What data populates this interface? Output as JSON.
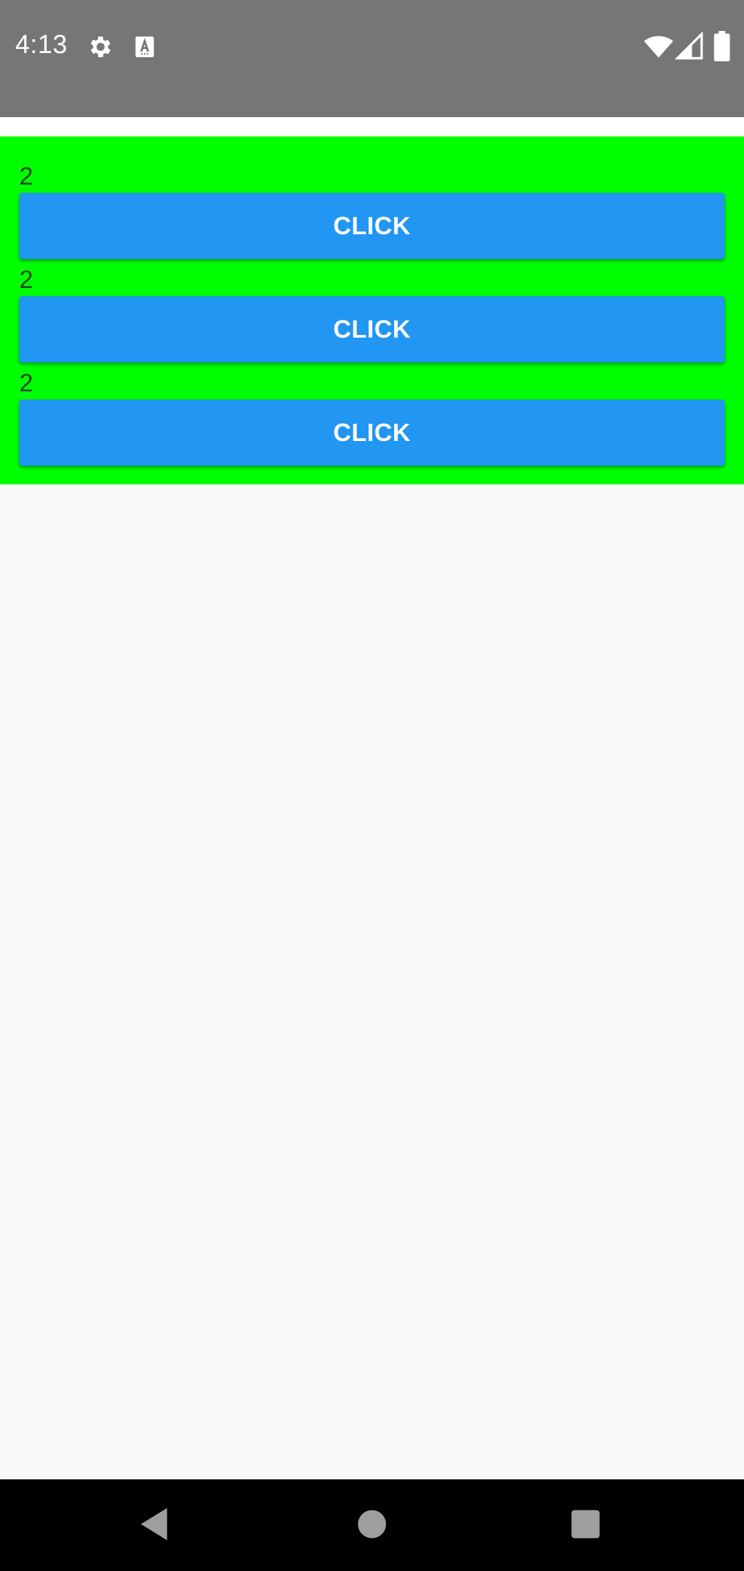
{
  "status_bar": {
    "time": "4:13",
    "icons": [
      "gear-icon",
      "text-a-icon",
      "wifi-icon",
      "signal-icon",
      "battery-icon"
    ],
    "background": "#767676"
  },
  "panel": {
    "background": "#00ff00",
    "items": [
      {
        "count": "2",
        "button_label": "CLICK"
      },
      {
        "count": "2",
        "button_label": "CLICK"
      },
      {
        "count": "2",
        "button_label": "CLICK"
      }
    ]
  },
  "colors": {
    "button": "#2196f3",
    "button_text": "#ffffff",
    "background": "#fafafa"
  },
  "nav_bar": {
    "buttons": [
      "back-icon",
      "home-icon",
      "recents-icon"
    ]
  }
}
